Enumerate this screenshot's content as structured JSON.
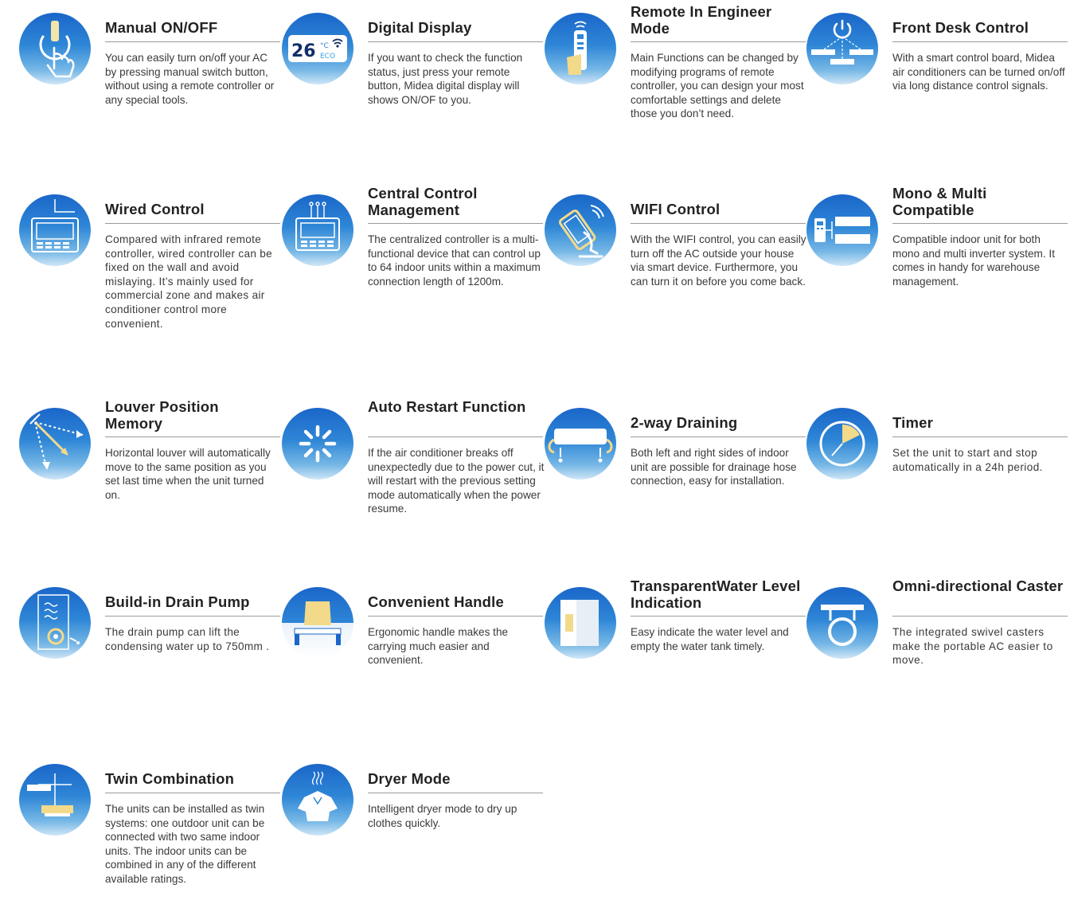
{
  "features": [
    {
      "title": "Manual ON/OFF",
      "desc": "You can easily turn on/off your AC by pressing manual switch button, without using a remote controller or any special tools."
    },
    {
      "title": "Digital Display",
      "desc": "If you want to check the function status, just press your remote button, Midea digital display will shows ON/OF to you.",
      "icon_text_main": "26",
      "icon_text_unit": "°C",
      "icon_text_eco": "ECO"
    },
    {
      "title": "Remote In Engineer Mode",
      "desc": "Main Functions can be changed by modifying programs of remote controller, you can design your most comfortable settings and delete those you don’t need."
    },
    {
      "title": "Front Desk Control",
      "desc": "With a smart control board, Midea air conditioners can be turned on/off via long distance control signals."
    },
    {
      "title": "Wired Control",
      "desc": "Compared with infrared remote controller, wired controller can be fixed on the wall and avoid mislaying. It’s mainly used for commercial zone and makes air conditioner control more convenient."
    },
    {
      "title": "Central Control Management",
      "desc": "The centralized controller is a multi-functional device that can control up to 64 indoor units within a maximum connection length of 1200m."
    },
    {
      "title": "WIFI Control",
      "desc": "With the WIFI control, you can easily turn off the AC outside your house via smart device. Furthermore, you can turn it on before you come back."
    },
    {
      "title": "Mono & Multi Compatible",
      "desc": "Compatible indoor unit for both mono and multi inverter system. It comes in handy for warehouse management."
    },
    {
      "title": "Louver Position Memory",
      "desc": "Horizontal louver will automatically move to the same position as you set last time when the unit turned on."
    },
    {
      "title": "Auto Restart Function",
      "desc": "If the air conditioner breaks off unexpectedly due to the power cut, it will restart with the previous setting mode automatically when the power resume."
    },
    {
      "title": "2-way Draining",
      "desc": "Both left and right sides of indoor unit are possible for drainage hose connection, easy for installation."
    },
    {
      "title": "Timer",
      "desc": "Set the unit to start and stop automatically in a 24h period."
    },
    {
      "title": "Build-in Drain Pump",
      "desc": "The drain pump can lift the condensing water up to 750mm ."
    },
    {
      "title": "Convenient Handle",
      "desc": "Ergonomic handle makes the carrying much easier and convenient."
    },
    {
      "title": "TransparentWater Level Indication",
      "desc": "Easy indicate the water level and empty the water tank timely."
    },
    {
      "title": "Omni-directional Caster",
      "desc": "The integrated swivel casters make the portable AC easier to move."
    },
    {
      "title": "Twin Combination",
      "desc": "The units can be installed as twin systems: one outdoor unit can be connected with two same indoor units. The indoor units can be combined in any of the different available ratings."
    },
    {
      "title": "Dryer Mode",
      "desc": "Intelligent dryer mode to dry up clothes quickly."
    }
  ]
}
